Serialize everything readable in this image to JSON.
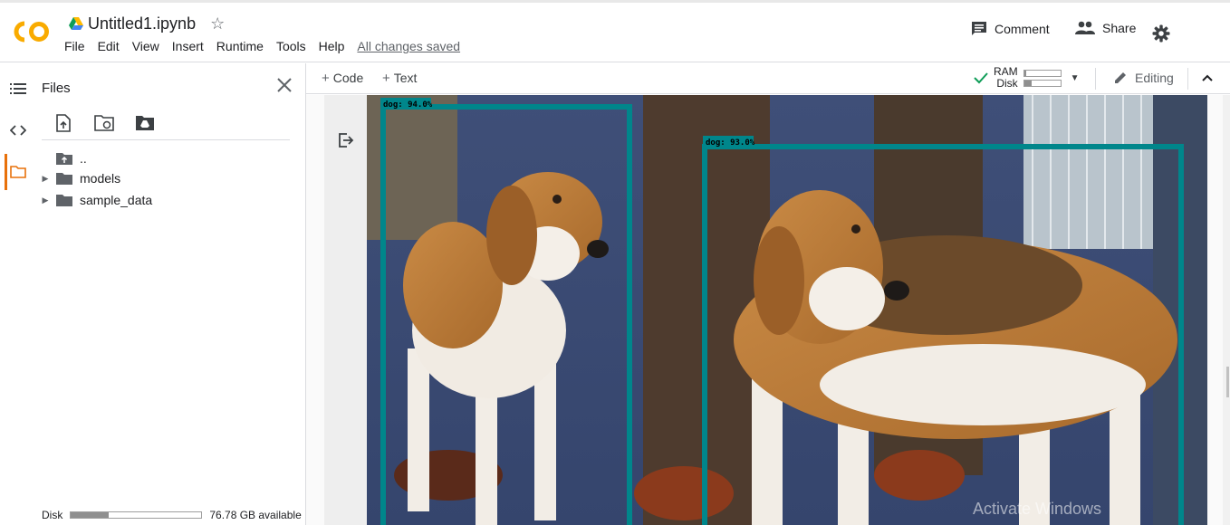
{
  "header": {
    "notebook_title": "Untitled1.ipynb",
    "menu": [
      "File",
      "Edit",
      "View",
      "Insert",
      "Runtime",
      "Tools",
      "Help"
    ],
    "save_status": "All changes saved",
    "comment_label": "Comment",
    "share_label": "Share",
    "logo_icon": "colab-logo",
    "accent_color": "#f9ab00"
  },
  "files_panel": {
    "title": "Files",
    "tree": [
      {
        "label": "..",
        "icon": "upload-folder-icon"
      },
      {
        "label": "models",
        "icon": "folder-icon"
      },
      {
        "label": "sample_data",
        "icon": "folder-icon"
      }
    ],
    "disk_label": "Disk",
    "disk_available": "76.78 GB available",
    "disk_used_fraction": 0.29
  },
  "toolbar": {
    "add_code": "Code",
    "add_text": "Text",
    "ram_label": "RAM",
    "disk_label": "Disk",
    "ram_used_fraction": 0.05,
    "disk_used_fraction": 0.22,
    "mode_label": "Editing",
    "connected_color": "#0f9d58"
  },
  "output": {
    "detections": [
      {
        "label": "dog: 94.0%",
        "color": "#00868b"
      },
      {
        "label": "dog: 93.0%",
        "color": "#00868b"
      }
    ]
  },
  "watermark": "Activate Windows"
}
